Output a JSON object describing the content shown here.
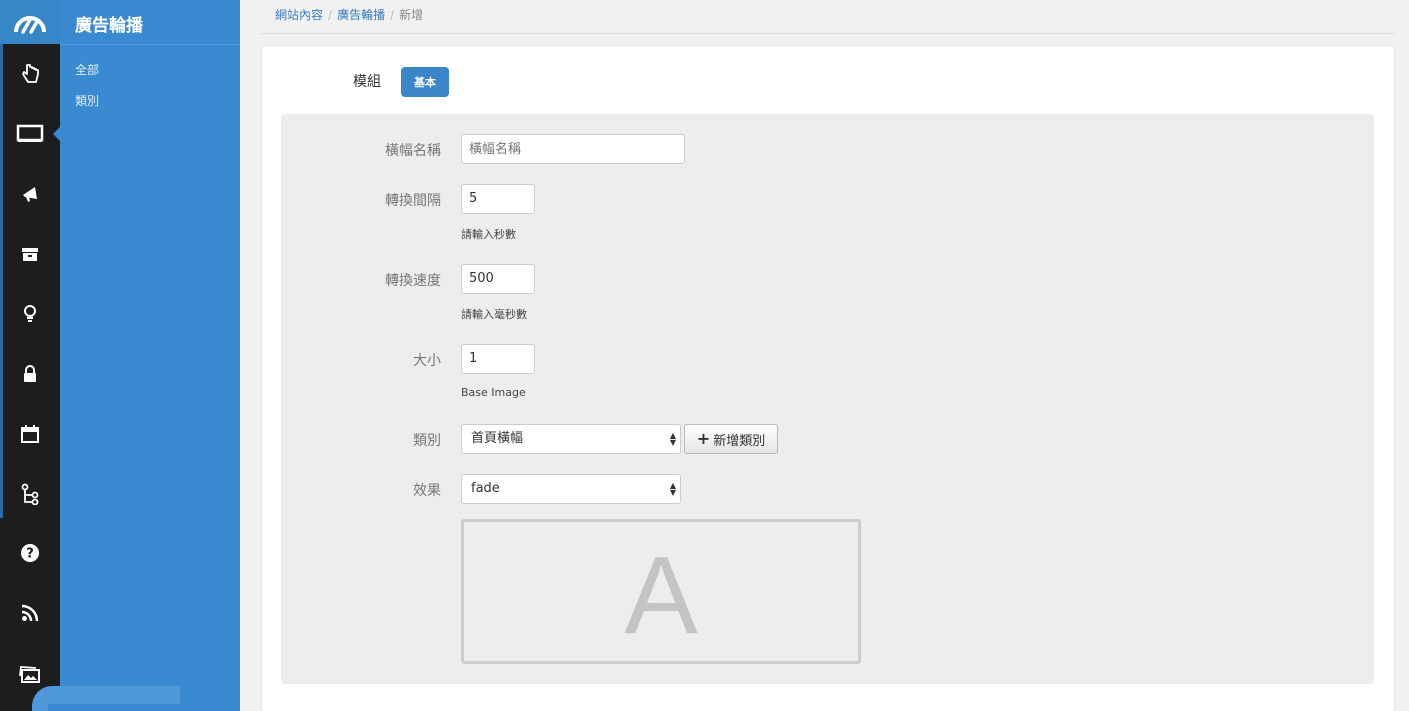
{
  "rail": {
    "icons": [
      "logo-icon",
      "pointer-icon",
      "monitor-icon",
      "megaphone-icon",
      "archive-icon",
      "lightbulb-icon",
      "lock-icon",
      "calendar-icon",
      "sitemap-icon",
      "question-icon",
      "rss-icon",
      "gallery-icon"
    ]
  },
  "sidebar": {
    "title": "廣告輪播",
    "items": [
      {
        "label": "全部"
      },
      {
        "label": "類別"
      }
    ]
  },
  "breadcrumb": {
    "items": [
      "網站內容",
      "廣告輪播",
      "新增"
    ]
  },
  "module": {
    "label": "模組",
    "tab_label": "基本"
  },
  "form": {
    "banner_name": {
      "label": "橫幅名稱",
      "placeholder": "橫幅名稱",
      "value": ""
    },
    "interval": {
      "label": "轉換間隔",
      "value": "5",
      "help": "請輸入秒數"
    },
    "speed": {
      "label": "轉換速度",
      "value": "500",
      "help": "請輸入毫秒數"
    },
    "size": {
      "label": "大小",
      "value": "1",
      "help": "Base Image"
    },
    "category": {
      "label": "類別",
      "selected": "首頁橫幅",
      "add_button": "新增類別"
    },
    "effect": {
      "label": "效果",
      "selected": "fade"
    },
    "preview": {
      "letter": "A"
    }
  },
  "colors": {
    "rail_bg": "#1d1d1d",
    "sidebar_bg": "#3a8ad2",
    "accent": "#3a86c8",
    "form_bg": "#ededed"
  }
}
